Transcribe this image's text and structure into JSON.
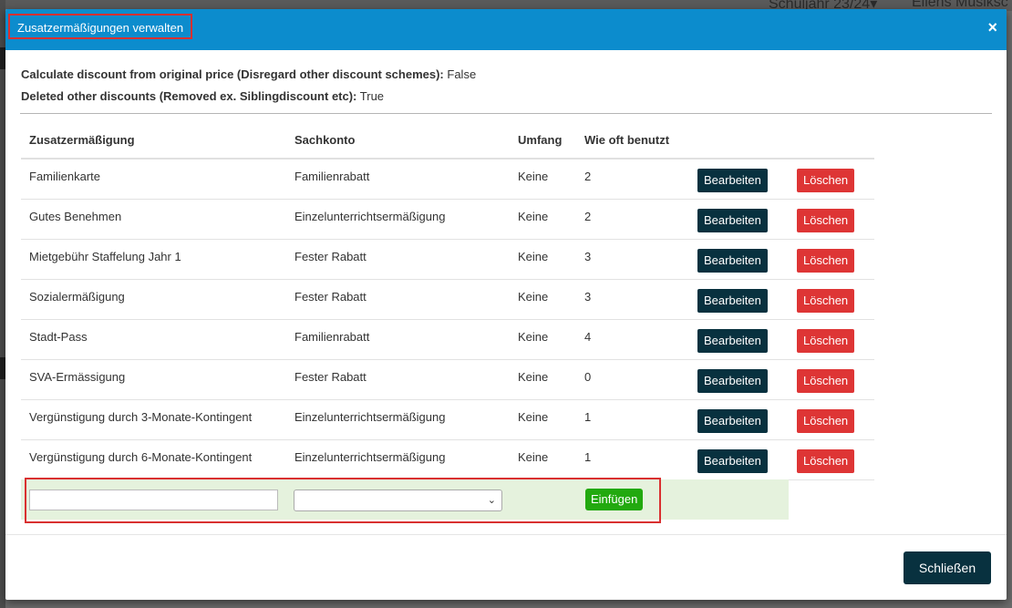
{
  "background": {
    "school_year": "Schuljahr 23/24",
    "school_year_caret": "▾",
    "school_name": "Ellens Musiksc"
  },
  "modal": {
    "title": "Zusatzermäßigungen verwalten",
    "close_icon": "×",
    "info": [
      {
        "label": "Calculate discount from original price (Disregard other discount schemes):",
        "value": "False"
      },
      {
        "label": "Deleted other discounts (Removed ex. Siblingdiscount etc):",
        "value": "True"
      }
    ],
    "table": {
      "headers": [
        "Zusatzermäßigung",
        "Sachkonto",
        "Umfang",
        "Wie oft benutzt"
      ],
      "edit_label": "Bearbeiten",
      "delete_label": "Löschen",
      "rows": [
        {
          "name": "Familienkarte",
          "konto": "Familienrabatt",
          "umfang": "Keine",
          "count": "2"
        },
        {
          "name": "Gutes Benehmen",
          "konto": "Einzelunterrichtsermäßigung",
          "umfang": "Keine",
          "count": "2"
        },
        {
          "name": "Mietgebühr Staffelung Jahr 1",
          "konto": "Fester Rabatt",
          "umfang": "Keine",
          "count": "3"
        },
        {
          "name": "Sozialermäßigung",
          "konto": "Fester Rabatt",
          "umfang": "Keine",
          "count": "3"
        },
        {
          "name": "Stadt-Pass",
          "konto": "Familienrabatt",
          "umfang": "Keine",
          "count": "4"
        },
        {
          "name": "SVA-Ermässigung",
          "konto": "Fester Rabatt",
          "umfang": "Keine",
          "count": "0"
        },
        {
          "name": "Vergünstigung durch 3-Monate-Kontingent",
          "konto": "Einzelunterrichtsermäßigung",
          "umfang": "Keine",
          "count": "1"
        },
        {
          "name": "Vergünstigung durch 6-Monate-Kontingent",
          "konto": "Einzelunterrichtsermäßigung",
          "umfang": "Keine",
          "count": "1"
        }
      ]
    },
    "insert": {
      "name_value": "",
      "konto_value": "",
      "chevron": "⌄",
      "insert_label": "Einfügen"
    },
    "close_label": "Schließen"
  }
}
